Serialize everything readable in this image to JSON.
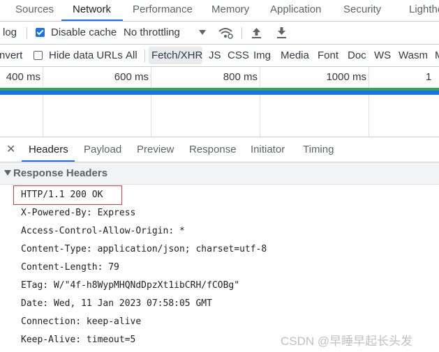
{
  "devtools": {
    "tabs": [
      {
        "label": "Sources"
      },
      {
        "label": "Network"
      },
      {
        "label": "Performance"
      },
      {
        "label": "Memory"
      },
      {
        "label": "Application"
      },
      {
        "label": "Security"
      },
      {
        "label": "Lighthe"
      }
    ],
    "active_tab": "Network"
  },
  "toolbar": {
    "preserve_log_label": "log",
    "disable_cache_label": "Disable cache",
    "disable_cache_checked": true,
    "throttling_value": "No throttling"
  },
  "filters": {
    "invert_label": "nvert",
    "hide_data_urls_label": "Hide data URLs",
    "hide_data_urls_checked": false,
    "types": [
      "All",
      "Fetch/XHR",
      "JS",
      "CSS",
      "Img",
      "Media",
      "Font",
      "Doc",
      "WS",
      "Wasm",
      "M"
    ],
    "selected_type": "Fetch/XHR"
  },
  "timeline": {
    "ticks": [
      "400 ms",
      "600 ms",
      "800 ms",
      "1000 ms",
      "1"
    ]
  },
  "panel": {
    "tabs": [
      "Headers",
      "Payload",
      "Preview",
      "Response",
      "Initiator",
      "Timing"
    ],
    "active_tab": "Headers"
  },
  "response_headers": {
    "title": "Response Headers",
    "status_line": "HTTP/1.1 200 OK",
    "lines": [
      "X-Powered-By: Express",
      "Access-Control-Allow-Origin: *",
      "Content-Type: application/json; charset=utf-8",
      "Content-Length: 79",
      "ETag: W/\"4f-h8WypMHQNdDpzXt1ibCRH/fCOBg\"",
      "Date: Wed, 11 Jan 2023 07:58:05 GMT",
      "Connection: keep-alive",
      "Keep-Alive: timeout=5"
    ]
  },
  "watermark": "CSDN @早睡早起长头发",
  "colors": {
    "accent": "#1a73e8",
    "highlight_box": "#e03a3a",
    "timeline_green": "#32a852"
  }
}
